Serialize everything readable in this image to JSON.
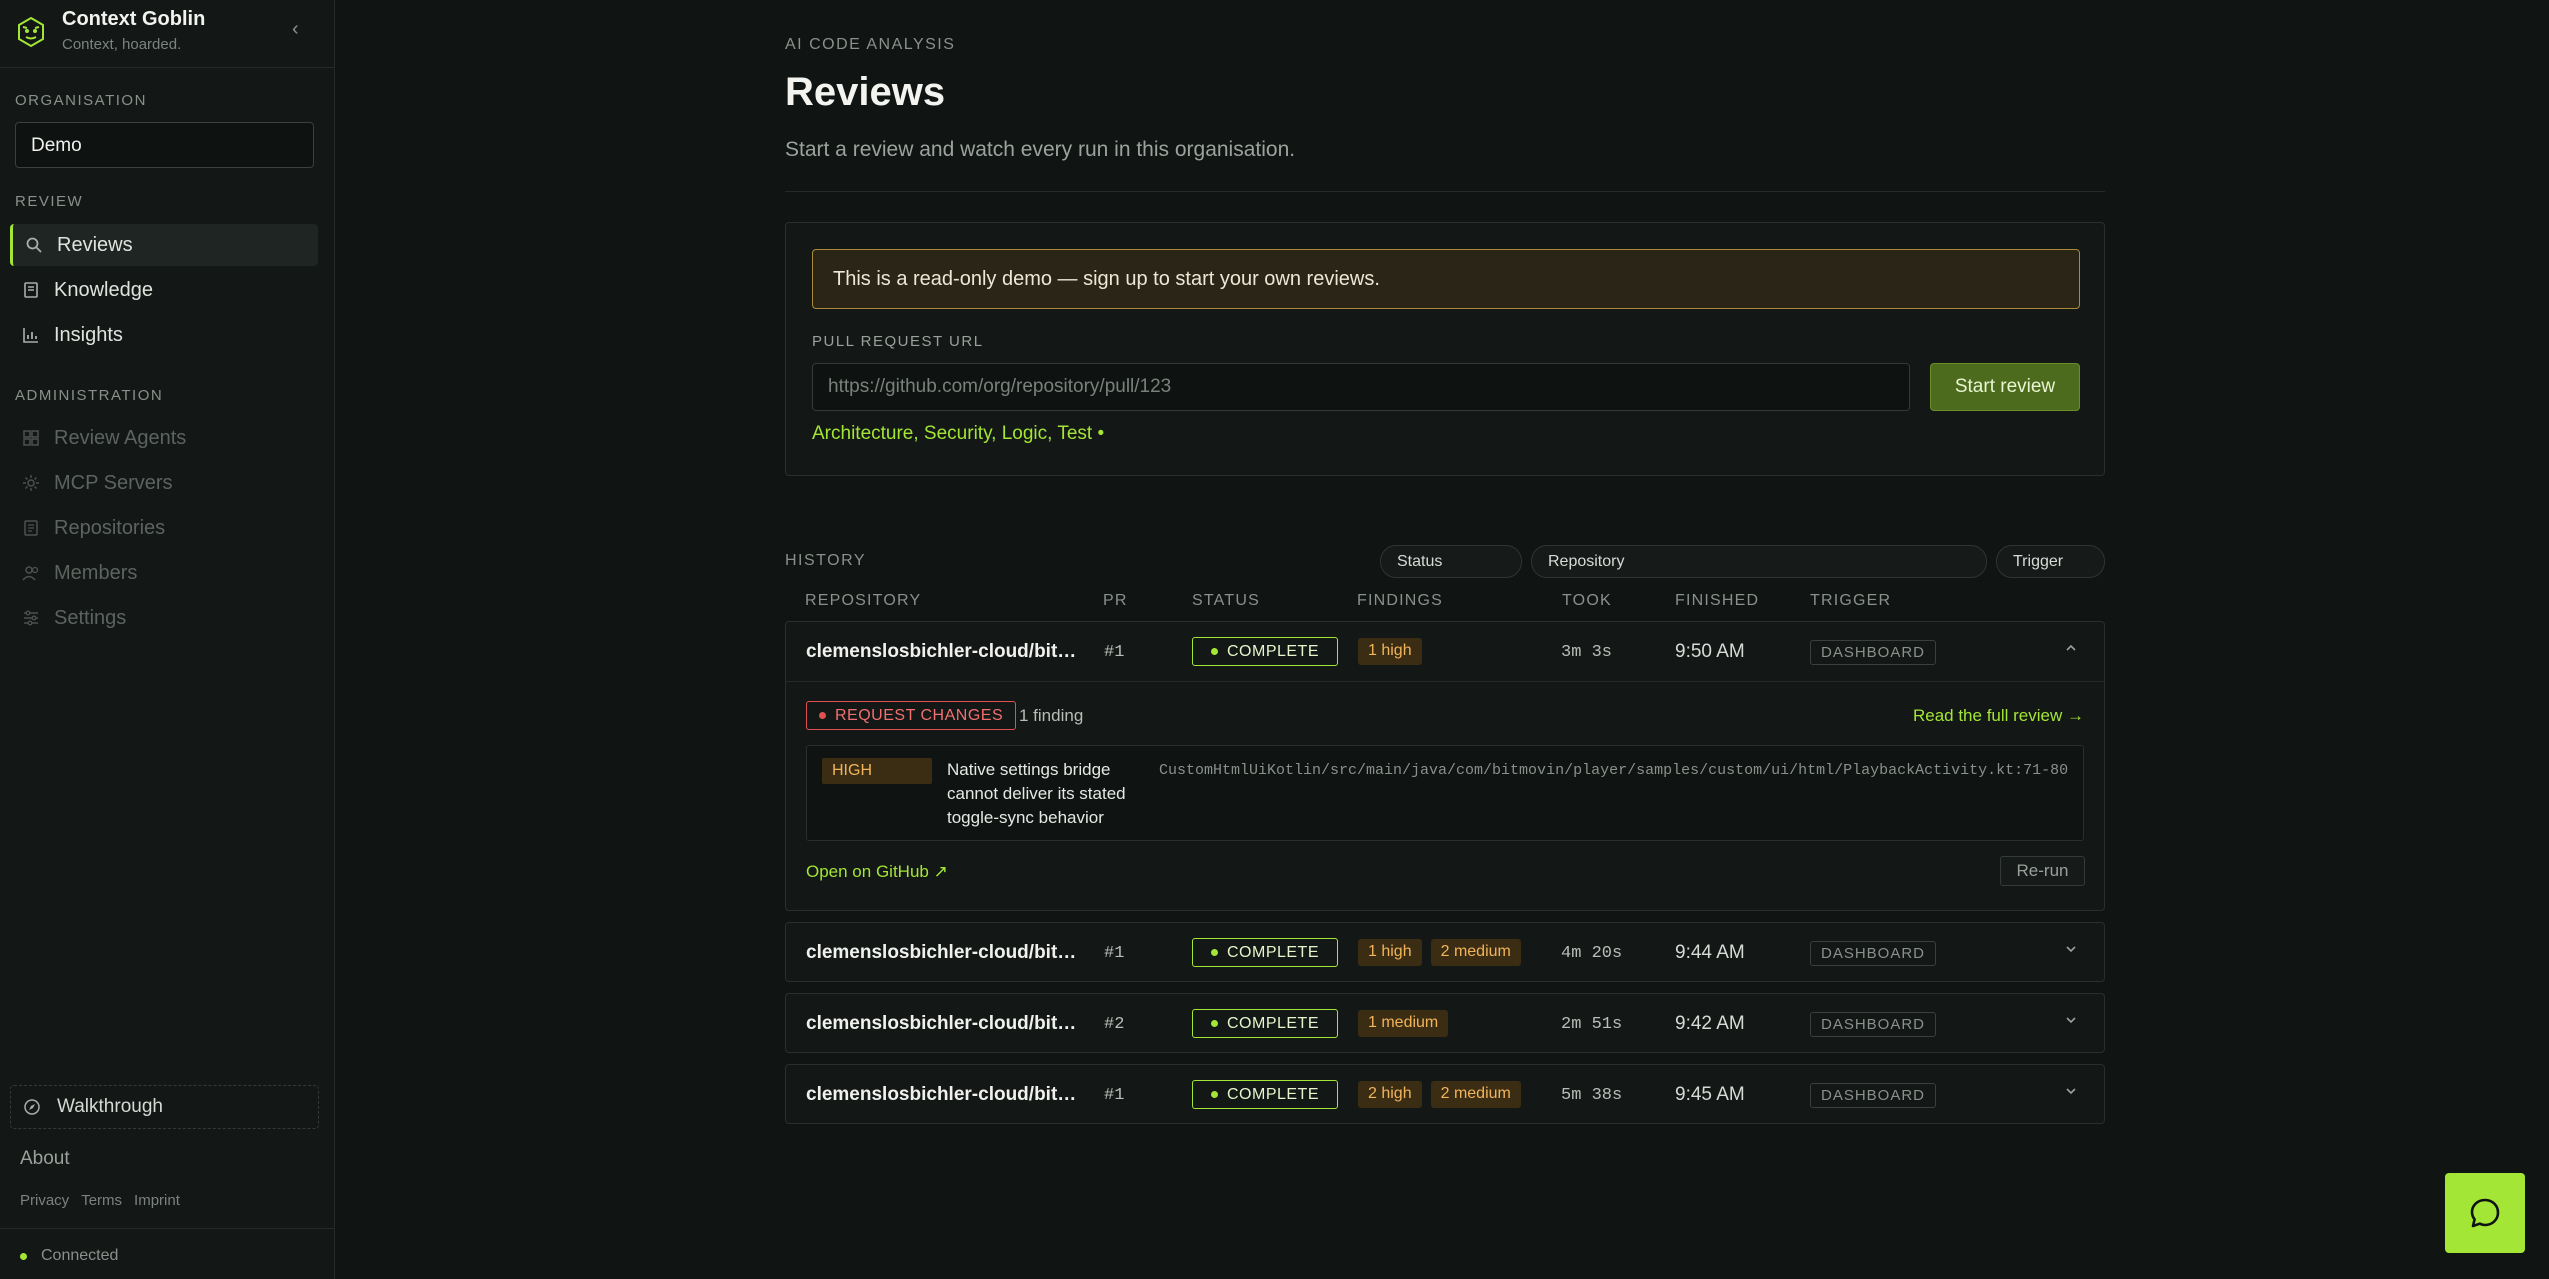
{
  "brand": {
    "name": "Context Goblin",
    "tagline": "Context, hoarded."
  },
  "sidebar": {
    "org_label": "ORGANISATION",
    "org_value": "Demo",
    "review_label": "REVIEW",
    "review_items": [
      {
        "label": "Reviews",
        "icon": "search-icon"
      },
      {
        "label": "Knowledge",
        "icon": "book-icon"
      },
      {
        "label": "Insights",
        "icon": "bar-chart-icon"
      }
    ],
    "admin_label": "ADMINISTRATION",
    "admin_items": [
      {
        "label": "Review Agents",
        "icon": "grid-icon"
      },
      {
        "label": "MCP Servers",
        "icon": "server-icon"
      },
      {
        "label": "Repositories",
        "icon": "repo-icon"
      },
      {
        "label": "Members",
        "icon": "users-icon"
      },
      {
        "label": "Settings",
        "icon": "sliders-icon"
      }
    ],
    "walkthrough": "Walkthrough",
    "about": "About",
    "legal": [
      "Privacy",
      "Terms",
      "Imprint"
    ],
    "connection": "Connected"
  },
  "page": {
    "eyebrow": "AI CODE ANALYSIS",
    "title": "Reviews",
    "subtitle": "Start a review and watch every run in this organisation."
  },
  "review_form": {
    "banner": "This is a read-only demo — sign up to start your own reviews.",
    "url_label": "PULL REQUEST URL",
    "url_placeholder": "https://github.com/org/repository/pull/123",
    "start_label": "Start review",
    "agents": "Architecture, Security, Logic, Test •"
  },
  "history": {
    "label": "HISTORY",
    "filters": {
      "status": "Status",
      "repository": "Repository",
      "trigger": "Trigger"
    },
    "columns": [
      "REPOSITORY",
      "PR",
      "STATUS",
      "FINDINGS",
      "TOOK",
      "FINISHED",
      "TRIGGER"
    ],
    "rows": [
      {
        "repo": "clemenslosbichler-cloud/bitmovin-player-android-samples",
        "pr": "#1",
        "status": "COMPLETE",
        "findings": [
          "1 high"
        ],
        "took": "3m 3s",
        "finished": "9:50 AM",
        "trigger": "DASHBOARD",
        "expanded": true,
        "detail": {
          "verdict": "REQUEST CHANGES",
          "finding_count": "1 finding",
          "read_full": "Read the full review →",
          "severity": "HIGH",
          "finding_title": "Native settings bridge cannot deliver its stated toggle-sync behavior",
          "finding_path": "CustomHtmlUiKotlin/src/main/java/com/bitmovin/player/samples/custom/ui/html/PlaybackActivity.kt:71-80",
          "github_link": "Open on GitHub ↗",
          "rerun": "Re-run"
        }
      },
      {
        "repo": "clemenslosbichler-cloud/bitmovin-player-android-samples",
        "pr": "#1",
        "status": "COMPLETE",
        "findings": [
          "1 high",
          "2 medium"
        ],
        "took": "4m 20s",
        "finished": "9:44 AM",
        "trigger": "DASHBOARD"
      },
      {
        "repo": "clemenslosbichler-cloud/bitmovin-player-android-samples",
        "pr": "#2",
        "status": "COMPLETE",
        "findings": [
          "1 medium"
        ],
        "took": "2m 51s",
        "finished": "9:42 AM",
        "trigger": "DASHBOARD"
      },
      {
        "repo": "clemenslosbichler-cloud/bitmovin-player-android-samples",
        "pr": "#1",
        "status": "COMPLETE",
        "findings": [
          "2 high",
          "2 medium"
        ],
        "took": "5m 38s",
        "finished": "9:45 AM",
        "trigger": "DASHBOARD"
      }
    ]
  },
  "colors": {
    "accent": "#a3e635",
    "warning": "#f2b45a",
    "danger": "#e05252",
    "background": "#101413"
  }
}
